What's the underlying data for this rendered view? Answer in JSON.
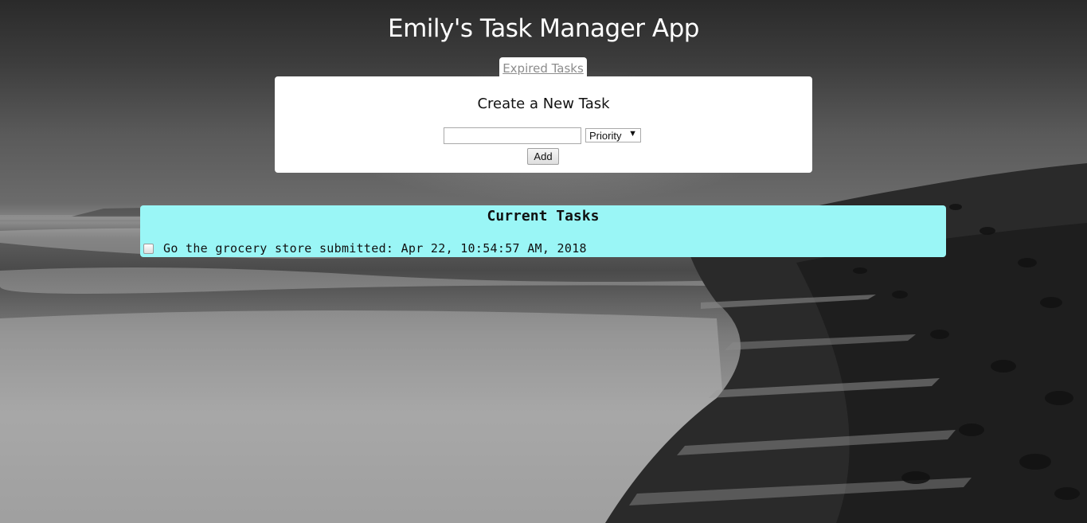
{
  "app": {
    "title": "Emily's Task Manager App"
  },
  "nav": {
    "expired_tasks_link": "Expired Tasks"
  },
  "create_task": {
    "heading": "Create a New Task",
    "task_input_value": "",
    "priority_select": {
      "selected": "Priority"
    },
    "add_button_label": "Add"
  },
  "current_tasks": {
    "heading": "Current Tasks",
    "items": [
      {
        "checked": false,
        "text": "Go the grocery store submitted: Apr 22, 10:54:57 AM, 2018"
      }
    ]
  },
  "colors": {
    "tasks_panel_bg": "#9af6f6",
    "panel_bg": "#ffffff",
    "title_color": "#ffffff",
    "link_color": "#8c8c8c"
  },
  "icons": {
    "dropdown": "chevron-down-icon"
  }
}
